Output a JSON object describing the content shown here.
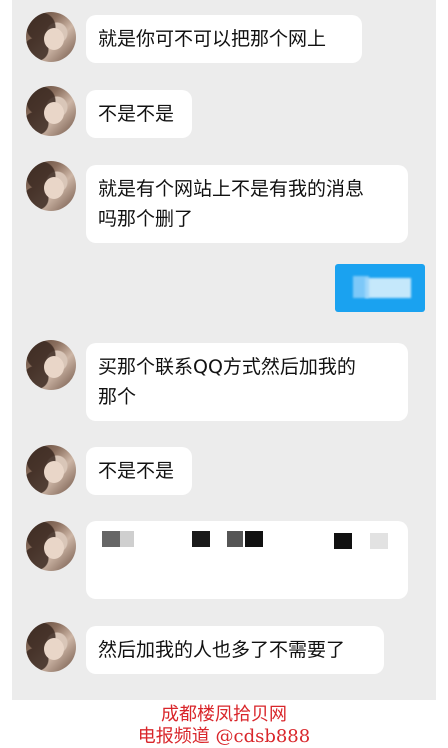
{
  "messages": [
    {
      "text": "就是你可不可以把那个网上"
    },
    {
      "text": "不是不是"
    },
    {
      "text": "就是有个网站上不是有我的消息\n吗那个删了"
    },
    {
      "text": "买那个联系QQ方式然后加我的\n那个"
    },
    {
      "text": "不是不是"
    },
    {
      "text": ""
    },
    {
      "text": "然后加我的人也多了不需要了"
    }
  ],
  "watermark": {
    "line1": "成都楼凤拾贝网",
    "line2": "电报频道 @cdsb888"
  },
  "colors": {
    "chat_background": "#ececec",
    "sent_bubble": "#1aa2f0",
    "watermark": "#d9262b"
  }
}
